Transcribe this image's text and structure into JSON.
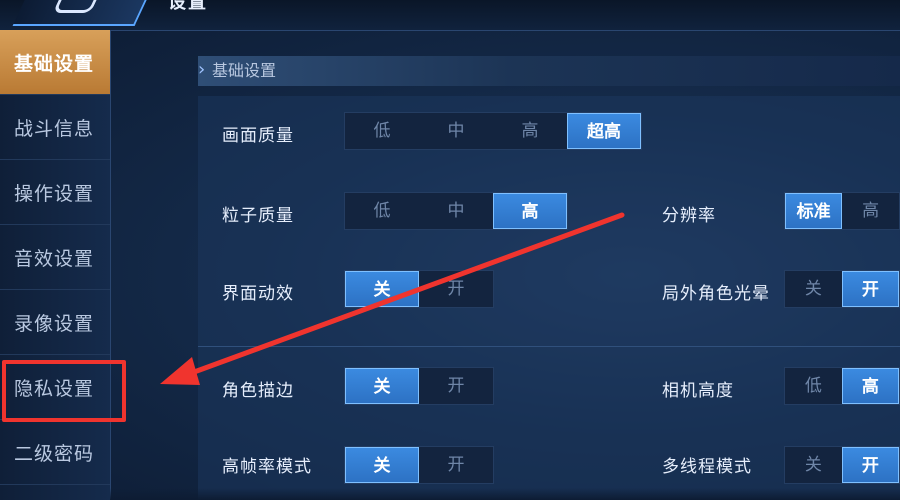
{
  "header": {
    "title": "设置"
  },
  "sidebar": {
    "items": [
      {
        "label": "基础设置"
      },
      {
        "label": "战斗信息"
      },
      {
        "label": "操作设置"
      },
      {
        "label": "音效设置"
      },
      {
        "label": "录像设置"
      },
      {
        "label": "隐私设置"
      },
      {
        "label": "二级密码"
      }
    ]
  },
  "section": {
    "title": "基础设置"
  },
  "settings": {
    "graphics_quality": {
      "label": "画面质量",
      "options": [
        "低",
        "中",
        "高",
        "超高"
      ],
      "selected": "超高"
    },
    "particle_quality": {
      "label": "粒子质量",
      "options": [
        "低",
        "中",
        "高"
      ],
      "selected": "高"
    },
    "resolution": {
      "label": "分辨率",
      "options": [
        "标准",
        "高"
      ],
      "selected": "标准"
    },
    "ui_animation": {
      "label": "界面动效",
      "options": [
        "关",
        "开"
      ],
      "selected": "关"
    },
    "outside_glow": {
      "label": "局外角色光晕",
      "options": [
        "关",
        "开"
      ],
      "selected": "开"
    },
    "character_outline": {
      "label": "角色描边",
      "options": [
        "关",
        "开"
      ],
      "selected": "关"
    },
    "camera_height": {
      "label": "相机高度",
      "options": [
        "低",
        "高"
      ],
      "selected": "高"
    },
    "high_fps_mode": {
      "label": "高帧率模式",
      "options": [
        "关",
        "开"
      ],
      "selected": "关"
    },
    "multithread_mode": {
      "label": "多线程模式",
      "options": [
        "关",
        "开"
      ],
      "selected": "开"
    }
  },
  "annotation": {
    "highlight_color": "#f0342e"
  }
}
